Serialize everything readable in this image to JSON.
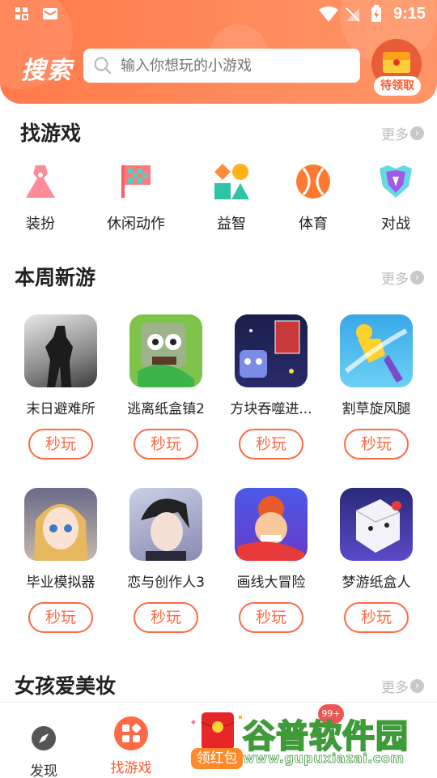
{
  "statusbar": {
    "time": "9:15"
  },
  "header": {
    "title": "搜索",
    "search_placeholder": "输入你想玩的小游戏",
    "reward_label": "待领取"
  },
  "find_games": {
    "title": "找游戏",
    "more": "更多",
    "categories": [
      {
        "label": "装扮",
        "icon": "dress-icon"
      },
      {
        "label": "休闲动作",
        "icon": "checkered-flag-icon"
      },
      {
        "label": "益智",
        "icon": "shapes-icon"
      },
      {
        "label": "体育",
        "icon": "tennis-ball-icon"
      },
      {
        "label": "对战",
        "icon": "shield-icon"
      }
    ]
  },
  "new_this_week": {
    "title": "本周新游",
    "more": "更多",
    "play_label": "秒玩",
    "games": [
      {
        "name": "末日避难所"
      },
      {
        "name": "逃离纸盒镇2"
      },
      {
        "name": "方块吞噬进..."
      },
      {
        "name": "割草旋风腿"
      },
      {
        "name": "毕业模拟器"
      },
      {
        "name": "恋与创作人3"
      },
      {
        "name": "画线大冒险"
      },
      {
        "name": "梦游纸盒人"
      }
    ]
  },
  "girls_makeup": {
    "title": "女孩爱美妆",
    "more": "更多"
  },
  "bottom_nav": {
    "items": [
      {
        "label": "发现",
        "icon": "compass-icon"
      },
      {
        "label": "找游戏",
        "icon": "game-grid-icon"
      },
      {
        "label": "领红包",
        "icon": "red-envelope-icon"
      }
    ],
    "badge": "99+"
  },
  "watermark": {
    "title": "谷普软件园",
    "url": "www.gupuxiazai.com"
  },
  "colors": {
    "accent": "#ff6a45",
    "header": "#ff7f52"
  }
}
